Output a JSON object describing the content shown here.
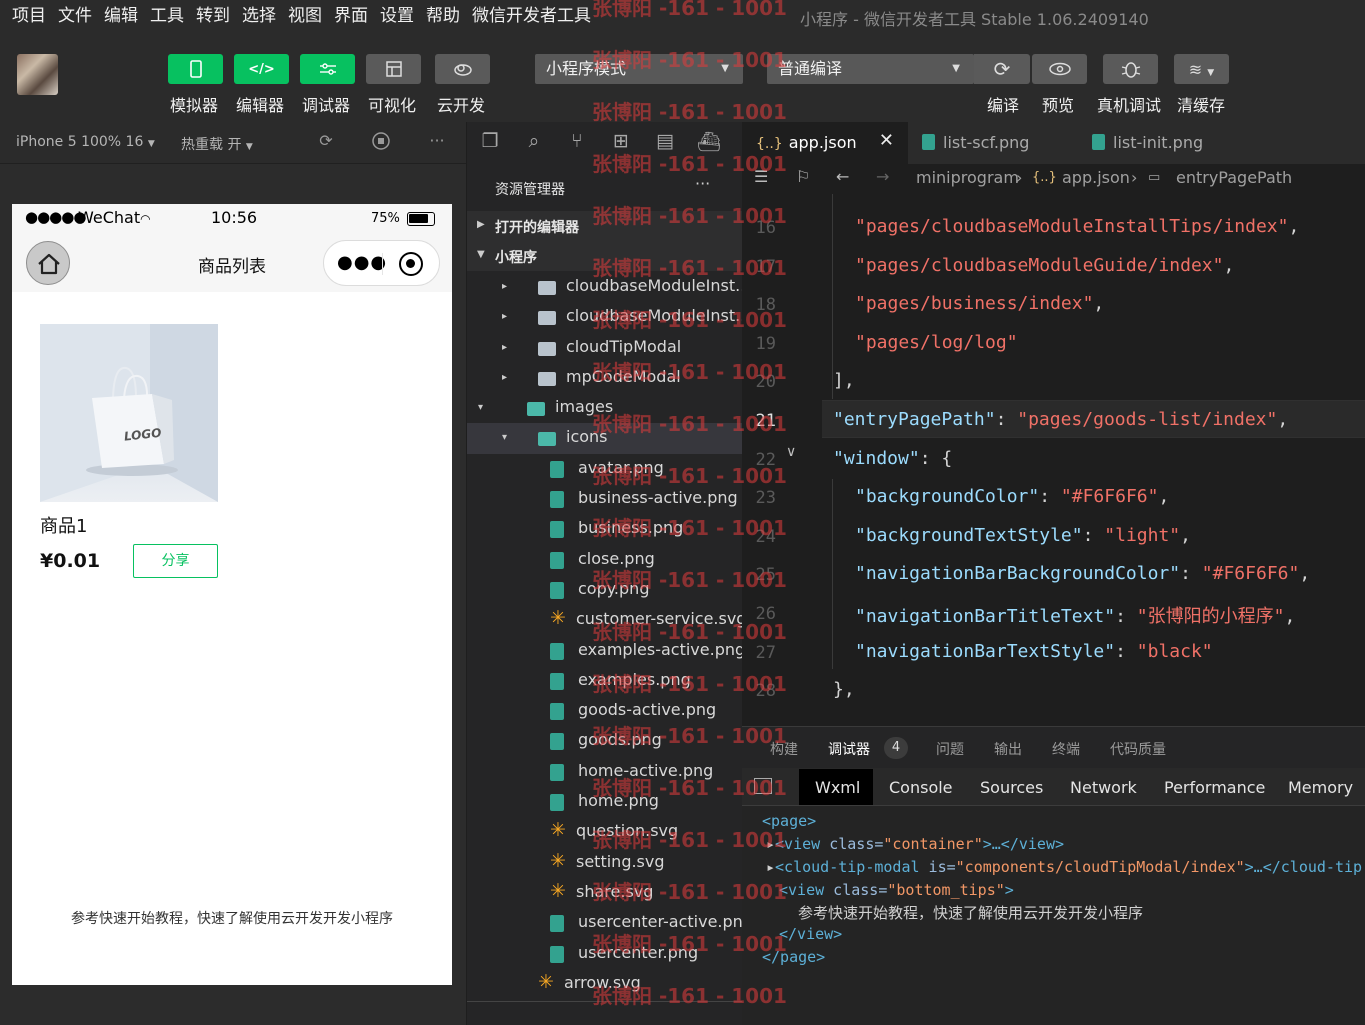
{
  "menu": [
    "项目",
    "文件",
    "编辑",
    "工具",
    "转到",
    "选择",
    "视图",
    "界面",
    "设置",
    "帮助",
    "微信开发者工具"
  ],
  "window_title": "小程序 - 微信开发者工具 Stable 1.06.2409140",
  "toolbar": {
    "simulator": "模拟器",
    "editor": "编辑器",
    "debugger": "调试器",
    "visual": "可视化",
    "cloud": "云开发",
    "mode_select": "小程序模式",
    "compile_select": "普通编译",
    "compile": "编译",
    "preview": "预览",
    "remote_debug": "真机调试",
    "clear_cache": "清缓存"
  },
  "simulator_bar": {
    "device": "iPhone 5 100% 16",
    "hot_reload": "热重载 开"
  },
  "phone": {
    "signal": "●●●●●",
    "carrier": "WeChat",
    "time": "10:56",
    "battery": "75%",
    "nav_title": "商品列表",
    "goods_name": "商品1",
    "goods_price": "¥0.01",
    "share_label": "分享",
    "image_logo": "LOGO",
    "bottom_tip": "参考快速开始教程，快速了解使用云开发开发小程序"
  },
  "explorer": {
    "title": "资源管理器",
    "more": "···",
    "open_editors": "打开的编辑器",
    "project": "小程序",
    "tree": [
      {
        "name": "cloudbaseModuleInst...",
        "type": "folder",
        "depth": 2,
        "arrow": "▸"
      },
      {
        "name": "cloudbaseModuleInst...",
        "type": "folder",
        "depth": 2,
        "arrow": "▸"
      },
      {
        "name": "cloudTipModal",
        "type": "folder",
        "depth": 2,
        "arrow": "▸"
      },
      {
        "name": "mpCodeModal",
        "type": "folder",
        "depth": 2,
        "arrow": "▸"
      },
      {
        "name": "images",
        "type": "folder-open",
        "depth": 1,
        "arrow": "▾"
      },
      {
        "name": "icons",
        "type": "folder-open",
        "depth": 2,
        "arrow": "▾",
        "selected": true
      },
      {
        "name": "avatar.png",
        "type": "png",
        "depth": 3
      },
      {
        "name": "business-active.png",
        "type": "png",
        "depth": 3
      },
      {
        "name": "business.png",
        "type": "png",
        "depth": 3
      },
      {
        "name": "close.png",
        "type": "png",
        "depth": 3
      },
      {
        "name": "copy.png",
        "type": "png",
        "depth": 3
      },
      {
        "name": "customer-service.svg",
        "type": "svg",
        "depth": 3
      },
      {
        "name": "examples-active.png",
        "type": "png",
        "depth": 3
      },
      {
        "name": "examples.png",
        "type": "png",
        "depth": 3
      },
      {
        "name": "goods-active.png",
        "type": "png",
        "depth": 3
      },
      {
        "name": "goods.png",
        "type": "png",
        "depth": 3
      },
      {
        "name": "home-active.png",
        "type": "png",
        "depth": 3
      },
      {
        "name": "home.png",
        "type": "png",
        "depth": 3
      },
      {
        "name": "question.svg",
        "type": "svg",
        "depth": 3
      },
      {
        "name": "setting.svg",
        "type": "svg",
        "depth": 3
      },
      {
        "name": "share.svg",
        "type": "svg",
        "depth": 3
      },
      {
        "name": "usercenter-active.png",
        "type": "png",
        "depth": 3
      },
      {
        "name": "usercenter.png",
        "type": "png",
        "depth": 3
      },
      {
        "name": "arrow.svg",
        "type": "svg",
        "depth": 2
      }
    ]
  },
  "tabs": [
    {
      "name": "app.json",
      "icon": "json-icon",
      "active": true
    },
    {
      "name": "list-scf.png",
      "icon": "png-icon",
      "active": false
    },
    {
      "name": "list-init.png",
      "icon": "png-icon",
      "active": false
    }
  ],
  "breadcrumb": {
    "root": "miniprogram",
    "file": "app.json",
    "symbol": "entryPagePath"
  },
  "editor": {
    "current_line": "21",
    "lines": [
      {
        "n": "16",
        "parts": [
          [
            "s",
            "\"pages/cloudbaseModuleInstallTips/index\""
          ],
          [
            "p",
            ","
          ]
        ],
        "indent": 1
      },
      {
        "n": "17",
        "parts": [
          [
            "s",
            "\"pages/cloudbaseModuleGuide/index\""
          ],
          [
            "p",
            ","
          ]
        ],
        "indent": 1
      },
      {
        "n": "18",
        "parts": [
          [
            "s",
            "\"pages/business/index\""
          ],
          [
            "p",
            ","
          ]
        ],
        "indent": 1
      },
      {
        "n": "19",
        "parts": [
          [
            "s",
            "\"pages/log/log\""
          ]
        ],
        "indent": 1
      },
      {
        "n": "20",
        "parts": [
          [
            "p",
            "],"
          ]
        ],
        "indent": 0
      },
      {
        "n": "21",
        "parts": [
          [
            "k",
            "\"entryPagePath\""
          ],
          [
            "p",
            ": "
          ],
          [
            "s",
            "\"pages/goods-list/index\""
          ],
          [
            "p",
            ","
          ]
        ],
        "indent": 0
      },
      {
        "n": "22",
        "parts": [
          [
            "k",
            "\"window\""
          ],
          [
            "p",
            ": {"
          ]
        ],
        "indent": 0
      },
      {
        "n": "23",
        "parts": [
          [
            "k",
            "\"backgroundColor\""
          ],
          [
            "p",
            ": "
          ],
          [
            "s",
            "\"#F6F6F6\""
          ],
          [
            "p",
            ","
          ]
        ],
        "indent": 1
      },
      {
        "n": "24",
        "parts": [
          [
            "k",
            "\"backgroundTextStyle\""
          ],
          [
            "p",
            ": "
          ],
          [
            "s",
            "\"light\""
          ],
          [
            "p",
            ","
          ]
        ],
        "indent": 1
      },
      {
        "n": "25",
        "parts": [
          [
            "k",
            "\"navigationBarBackgroundColor\""
          ],
          [
            "p",
            ": "
          ],
          [
            "s",
            "\"#F6F6F6\""
          ],
          [
            "p",
            ","
          ]
        ],
        "indent": 1
      },
      {
        "n": "26",
        "parts": [
          [
            "k",
            "\"navigationBarTitleText\""
          ],
          [
            "p",
            ": "
          ],
          [
            "s",
            "\"张博阳的小程序\""
          ],
          [
            "p",
            ","
          ]
        ],
        "indent": 1
      },
      {
        "n": "27",
        "parts": [
          [
            "k",
            "\"navigationBarTextStyle\""
          ],
          [
            "p",
            ": "
          ],
          [
            "s",
            "\"black\""
          ]
        ],
        "indent": 1
      },
      {
        "n": "28",
        "parts": [
          [
            "p",
            "},"
          ]
        ],
        "indent": 0
      }
    ]
  },
  "debug_tabs": {
    "build": "构建",
    "debugger": "调试器",
    "badge": "4",
    "issues": "问题",
    "output": "输出",
    "terminal": "终端",
    "quality": "代码质量"
  },
  "devtools_tabs": [
    "Wxml",
    "Console",
    "Sources",
    "Network",
    "Performance",
    "Memory"
  ],
  "wxml": {
    "page_open": "<page>",
    "view_tag": "<view",
    "class_attr": " class=",
    "container_val": "\"container\"",
    "view_close_ellipsis": ">…</view>",
    "cloud_tag": "<cloud-tip-modal",
    "is_attr": " is=",
    "cloud_val": "\"components/cloudTipModal/index\"",
    "cloud_close": ">…</cloud-tip",
    "bottom_val": "\"bottom_tips\"",
    "gt": ">",
    "bottom_text": "参考快速开始教程，快速了解使用云开发开发小程序",
    "view_close": "</view>",
    "page_close": "</page>"
  },
  "watermark": "张博阳 -161 - 1001",
  "colors": {
    "accent": "#07c160",
    "string": "#f07167",
    "key": "#9cdcfe"
  }
}
